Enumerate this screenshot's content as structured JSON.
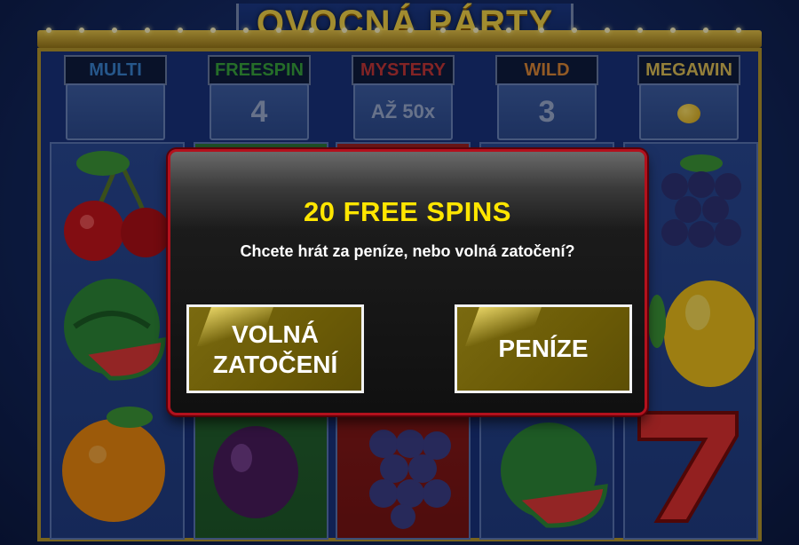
{
  "game_title": "OVOCNÁ PÁRTY",
  "features": [
    {
      "label": "MULTI",
      "value": "",
      "label_color": "#3b86d6"
    },
    {
      "label": "FREESPIN",
      "value": "4",
      "label_color": "#3aa83f"
    },
    {
      "label": "MYSTERY",
      "value": "AŽ 50x",
      "label_color": "#c8383a"
    },
    {
      "label": "WILD",
      "value": "3",
      "label_color": "#e08a3a"
    },
    {
      "label": "MEGAWIN",
      "value": "",
      "label_color": "#e2c35a",
      "icon": "lemon-icon"
    }
  ],
  "modal": {
    "title": "20 FREE SPINS",
    "subtitle": "Chcete hrát za peníze, nebo volná zatočení?",
    "free_spins_button": "VOLNÁ ZATOČENÍ",
    "money_button": "PENÍZE"
  },
  "colors": {
    "modal_title": "#ffe600",
    "modal_border": "#b3111d",
    "button_fill": "#6a5a06",
    "frame_gold": "#b99a2e"
  }
}
